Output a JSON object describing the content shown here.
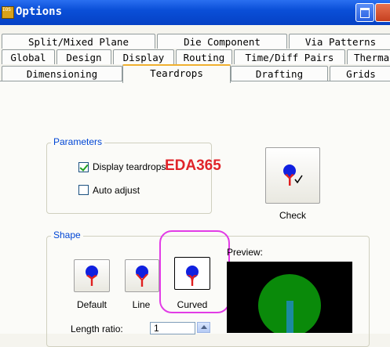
{
  "window": {
    "title": "Options",
    "app_icon_text": "IOS"
  },
  "tabs": {
    "row1": [
      "Split/Mixed Plane",
      "Die Component",
      "Via Patterns"
    ],
    "row2": [
      "Global",
      "Design",
      "Display",
      "Routing",
      "Time/Diff Pairs",
      "Therma"
    ],
    "row3": [
      "Dimensioning",
      "Teardrops",
      "Drafting",
      "Grids"
    ],
    "active": "Teardrops"
  },
  "parameters": {
    "group_label": "Parameters",
    "display_teardrops": {
      "label": "Display teardrops",
      "checked": true
    },
    "auto_adjust": {
      "label": "Auto adjust",
      "checked": false
    }
  },
  "check_button": {
    "label": "Check",
    "icon": "teardrop-check-icon"
  },
  "watermark": "EDA365",
  "shape": {
    "group_label": "Shape",
    "options": [
      {
        "label": "Default",
        "icon": "teardrop-default-icon"
      },
      {
        "label": "Line",
        "icon": "teardrop-line-icon"
      },
      {
        "label": "Curved",
        "icon": "teardrop-curved-icon",
        "selected": true
      }
    ],
    "preview_label": "Preview:",
    "length_ratio_label": "Length ratio:",
    "length_ratio_value": "1"
  },
  "colors": {
    "title_bar": "#0a4fd8",
    "group_label": "#0046d5",
    "teardrop_head": "#1020e0",
    "teardrop_neck": "#e02020",
    "preview_bg": "#000000",
    "preview_pad": "#0a8a0a",
    "preview_trace": "#1b8aa0",
    "highlight": "#e23ce6",
    "watermark": "#e0242a"
  }
}
